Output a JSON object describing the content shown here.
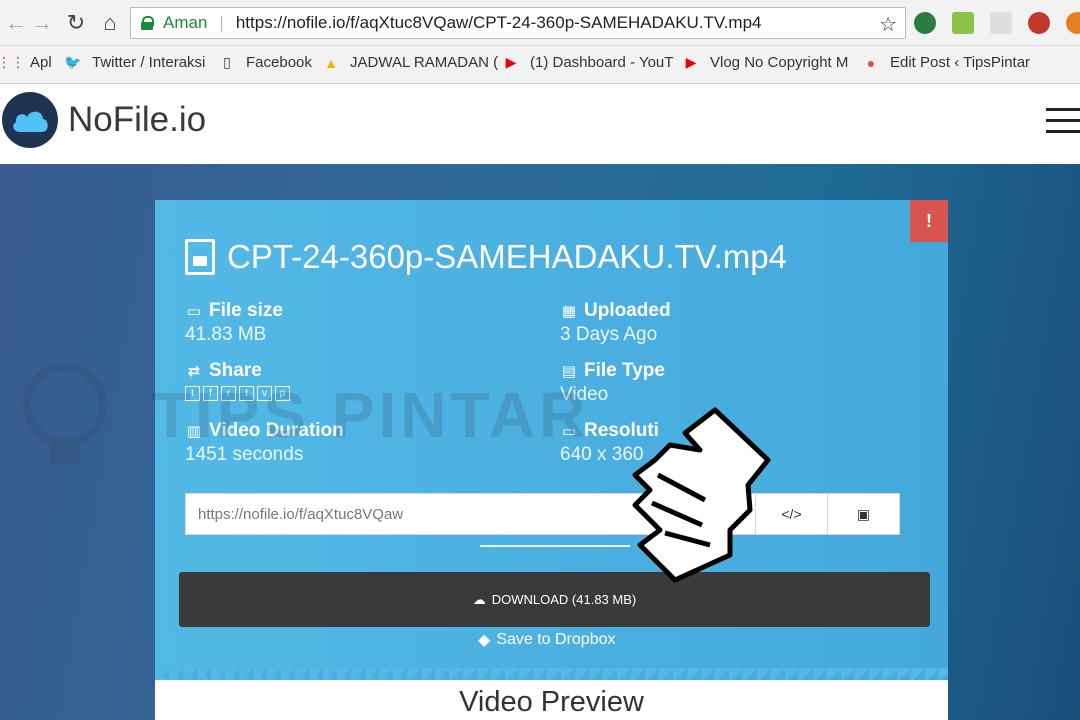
{
  "browser": {
    "secure_label": "Aman",
    "url": "https://nofile.io/f/aqXtuc8VQaw/CPT-24-360p-SAMEHADAKU.TV.mp4",
    "bookmarks": [
      {
        "label": "Apl",
        "icon": "apps-grid-icon"
      },
      {
        "label": "Twitter / Interaksi",
        "icon": "twitter-icon"
      },
      {
        "label": "Facebook",
        "icon": "page-icon"
      },
      {
        "label": "JADWAL RAMADAN (",
        "icon": "google-drive-icon"
      },
      {
        "label": "(1) Dashboard - YouT",
        "icon": "youtube-icon"
      },
      {
        "label": "Vlog No Copyright M",
        "icon": "youtube-icon"
      },
      {
        "label": "Edit Post ‹ TipsPintar",
        "icon": "blogger-icon"
      }
    ]
  },
  "site": {
    "name": "NoFile.io"
  },
  "file": {
    "title": "CPT-24-360p-SAMEHADAKU.TV.mp4",
    "size_label": "File size",
    "size_value": "41.83 MB",
    "uploaded_label": "Uploaded",
    "uploaded_value": "3 Days Ago",
    "share_label": "Share",
    "type_label": "File Type",
    "type_value": "Video",
    "duration_label": "Video Duration",
    "duration_value": "1451 seconds",
    "resolution_label": "Resoluti",
    "resolution_value": "640 x 360",
    "share_link": "https://nofile.io/f/aqXtuc8VQaw",
    "embed_label": "</>",
    "download_label": "DOWNLOAD (41.83 MB)",
    "dropbox_label": "Save to Dropbox",
    "report_label": "!",
    "preview_heading": "Video Preview"
  },
  "watermark": "TIPS PINTAR",
  "colors": {
    "card": "#4fb4e3",
    "download_button": "#3a3a3a",
    "report_button": "#d9534f",
    "page_background": "#2d6a9a"
  }
}
